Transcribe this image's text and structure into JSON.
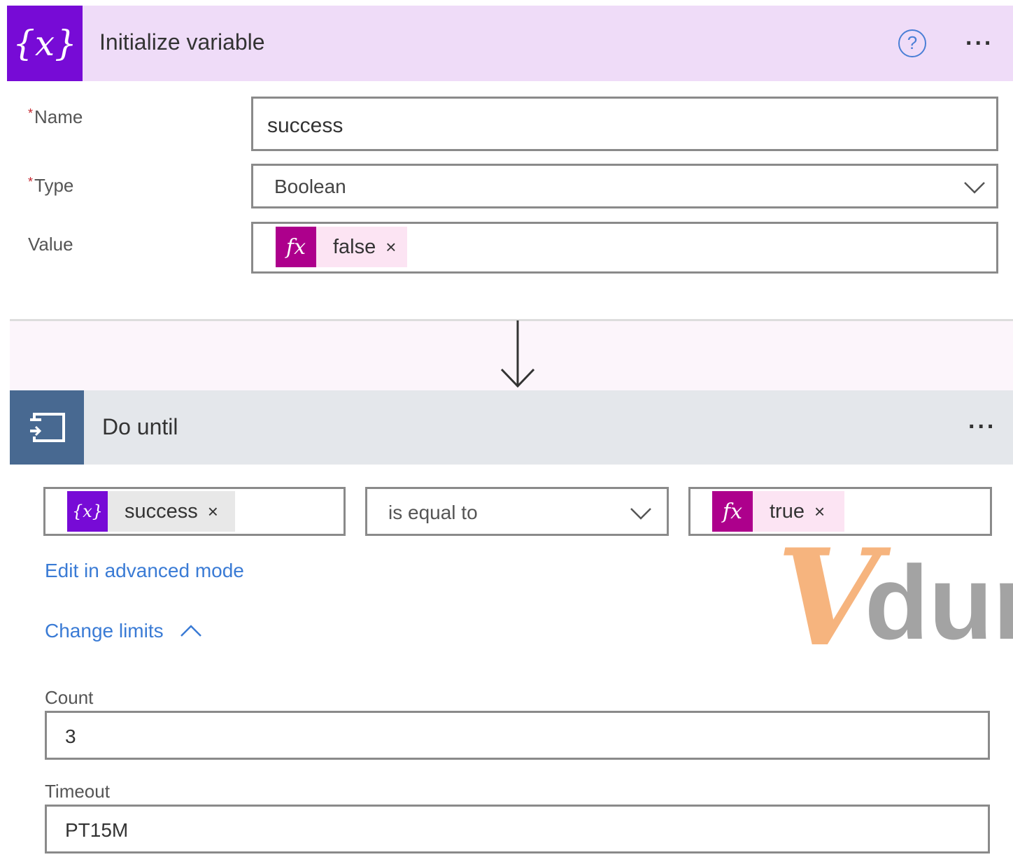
{
  "init_variable": {
    "title": "Initialize variable",
    "icon_label": "{x}",
    "help_glyph": "?",
    "more_glyph": "...",
    "name_label": "Name",
    "name_value": "success",
    "type_label": "Type",
    "type_value": "Boolean",
    "value_label": "Value",
    "value_token": {
      "icon": "fx",
      "label": "false",
      "remove": "×"
    },
    "required_marker": "*"
  },
  "do_until": {
    "title": "Do until",
    "more_glyph": "...",
    "condition": {
      "left_token": {
        "icon": "{x}",
        "label": "success",
        "remove": "×"
      },
      "operator": "is equal to",
      "right_token": {
        "icon": "fx",
        "label": "true",
        "remove": "×"
      }
    },
    "advanced_link": "Edit in advanced mode",
    "change_limits_link": "Change limits",
    "count_label": "Count",
    "count_value": "3",
    "timeout_label": "Timeout",
    "timeout_value": "PT15M"
  },
  "watermark": {
    "letter": "V",
    "text": "dur"
  },
  "colors": {
    "variable_purple": "#770bd6",
    "init_header_bg": "#efdcf8",
    "fx_magenta": "#ad008c",
    "loop_blue": "#486991",
    "until_header_bg": "#e4e7eb",
    "link_blue": "#3a7bd5"
  }
}
